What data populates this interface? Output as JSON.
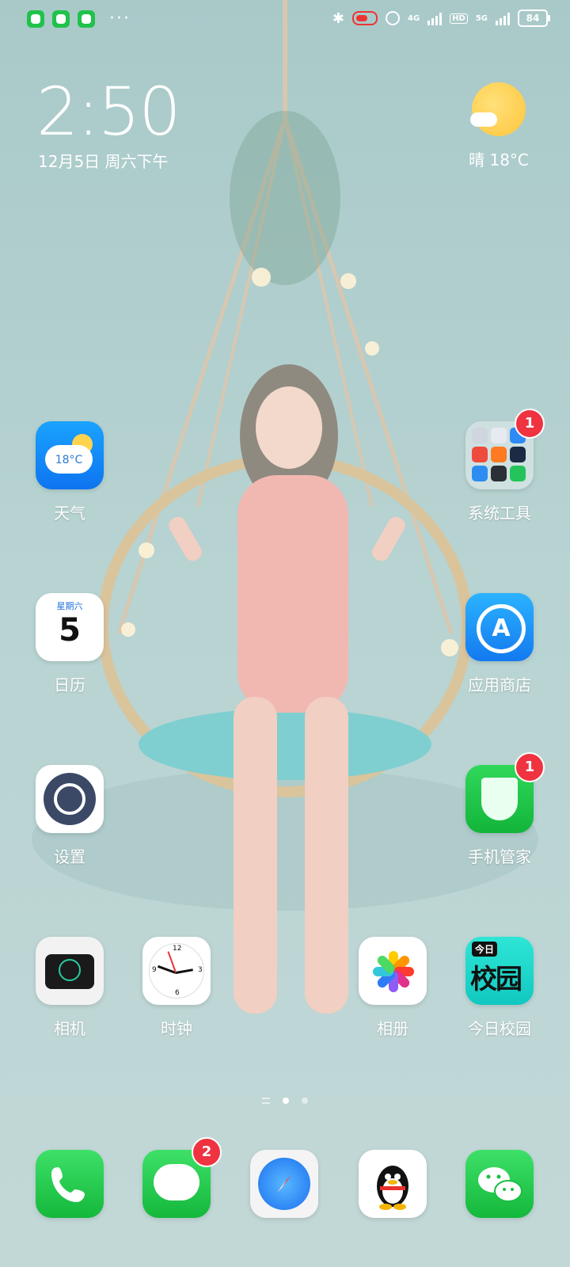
{
  "status_bar": {
    "left_apps": [
      "shield-app-icon",
      "message-app-icon",
      "wechat-app-icon"
    ],
    "overflow": "···",
    "network_4g": "4G",
    "hd": "HD",
    "network_5g": "5G",
    "battery": "84"
  },
  "clock": {
    "time": "2:50",
    "date": "12月5日 周六下午"
  },
  "weather": {
    "text": "晴   18°C"
  },
  "apps": [
    {
      "id": "weather",
      "label": "天气",
      "icon_text": "18°C"
    },
    {
      "id": "system-tools",
      "label": "系统工具",
      "badge": "1"
    },
    {
      "id": "calendar",
      "label": "日历",
      "weekday": "星期六",
      "day": "5"
    },
    {
      "id": "app-store",
      "label": "应用商店"
    },
    {
      "id": "settings",
      "label": "设置"
    },
    {
      "id": "phone-manager",
      "label": "手机管家",
      "badge": "1"
    },
    {
      "id": "camera",
      "label": "相机"
    },
    {
      "id": "clock",
      "label": "时钟",
      "numerals": [
        "12",
        "3",
        "6",
        "9"
      ]
    },
    {
      "id": "photos",
      "label": "相册"
    },
    {
      "id": "today-campus",
      "label": "今日校园",
      "tag": "今日",
      "big": "校园"
    }
  ],
  "dock": [
    {
      "id": "phone",
      "icon": "phone-icon"
    },
    {
      "id": "messages",
      "icon": "message-icon",
      "badge": "2"
    },
    {
      "id": "browser",
      "icon": "compass-icon"
    },
    {
      "id": "qq",
      "icon": "penguin-icon"
    },
    {
      "id": "wechat",
      "icon": "wechat-icon"
    }
  ],
  "colors": {
    "badge": "#ef3340",
    "wallpaper": "#b7d3d2",
    "green": "#14b83b"
  }
}
